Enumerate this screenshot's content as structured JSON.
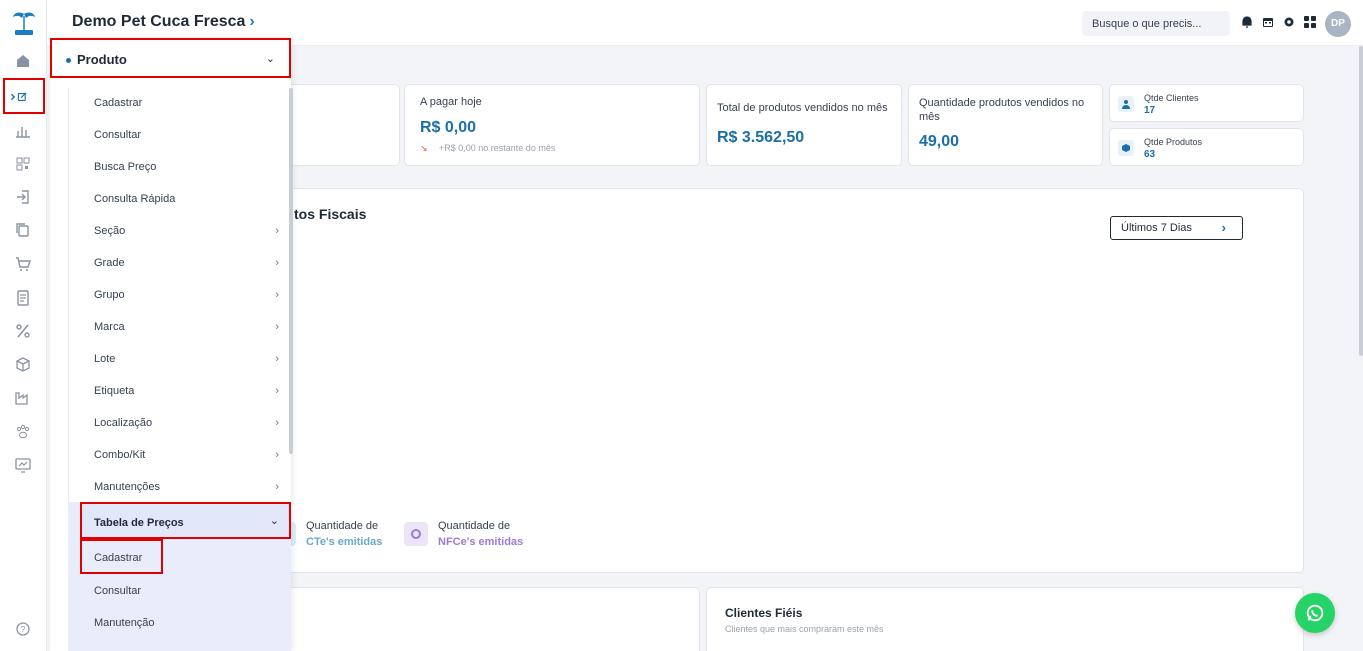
{
  "header": {
    "company": "Demo Pet Cuca Fresca",
    "search_placeholder": "Busque o que precis...",
    "avatar": "DP"
  },
  "icons": {
    "rail": [
      "logo-icon",
      "home-icon",
      "edit-icon",
      "chart-icon",
      "barcode-icon",
      "login-icon",
      "copy-icon",
      "cart-icon",
      "receipt-icon",
      "percent-icon",
      "box-icon",
      "factory-icon",
      "paw-icon",
      "monitor-icon",
      "help-icon"
    ],
    "header": [
      "bell-icon",
      "calendar-icon",
      "gear-icon",
      "grid-icon"
    ]
  },
  "cards": {
    "pagar_hoje": {
      "label": "A pagar hoje",
      "value": "R$ 0,00",
      "sub": "+R$ 0,00 no restante do mês"
    },
    "total_vendidos": {
      "label": "Total de produtos vendidos no mês",
      "value": "R$ 3.562,50"
    },
    "qtde_vendidos": {
      "label": "Quantidade produtos vendidos no mês",
      "value": "49,00"
    },
    "clientes": {
      "label": "Qtde Clientes",
      "value": "17"
    },
    "produtos": {
      "label": "Qtde Produtos",
      "value": "63"
    }
  },
  "fiscal": {
    "title_partial": "tos Fiscais",
    "period": "Últimos 7 Dias",
    "legend": [
      {
        "line1": "Quantidade de",
        "line2": "CTe's emitidas",
        "color": "#6aa9c9"
      },
      {
        "line1": "Quantidade de",
        "line2": "NFCe's emitidas",
        "color": "#9c7bd8"
      }
    ]
  },
  "clientes_fieis": {
    "title": "Clientes Fiéis",
    "subtitle": "Clientes que mais compraram este mês"
  },
  "menu": {
    "title": "Produto",
    "items": [
      {
        "label": "Cadastrar",
        "arrow": ""
      },
      {
        "label": "Consultar",
        "arrow": ""
      },
      {
        "label": "Busca Preço",
        "arrow": ""
      },
      {
        "label": "Consulta Rápida",
        "arrow": ""
      },
      {
        "label": "Seção",
        "arrow": "›"
      },
      {
        "label": "Grade",
        "arrow": "›"
      },
      {
        "label": "Grupo",
        "arrow": "›"
      },
      {
        "label": "Marca",
        "arrow": "›"
      },
      {
        "label": "Lote",
        "arrow": "›"
      },
      {
        "label": "Etiqueta",
        "arrow": "›"
      },
      {
        "label": "Localização",
        "arrow": "›"
      },
      {
        "label": "Combo/Kit",
        "arrow": "›"
      },
      {
        "label": "Manutenções",
        "arrow": "›"
      }
    ],
    "submenu": {
      "title": "Tabela de Preços",
      "items": [
        "Cadastrar",
        "Consultar",
        "Manutenção"
      ]
    }
  }
}
